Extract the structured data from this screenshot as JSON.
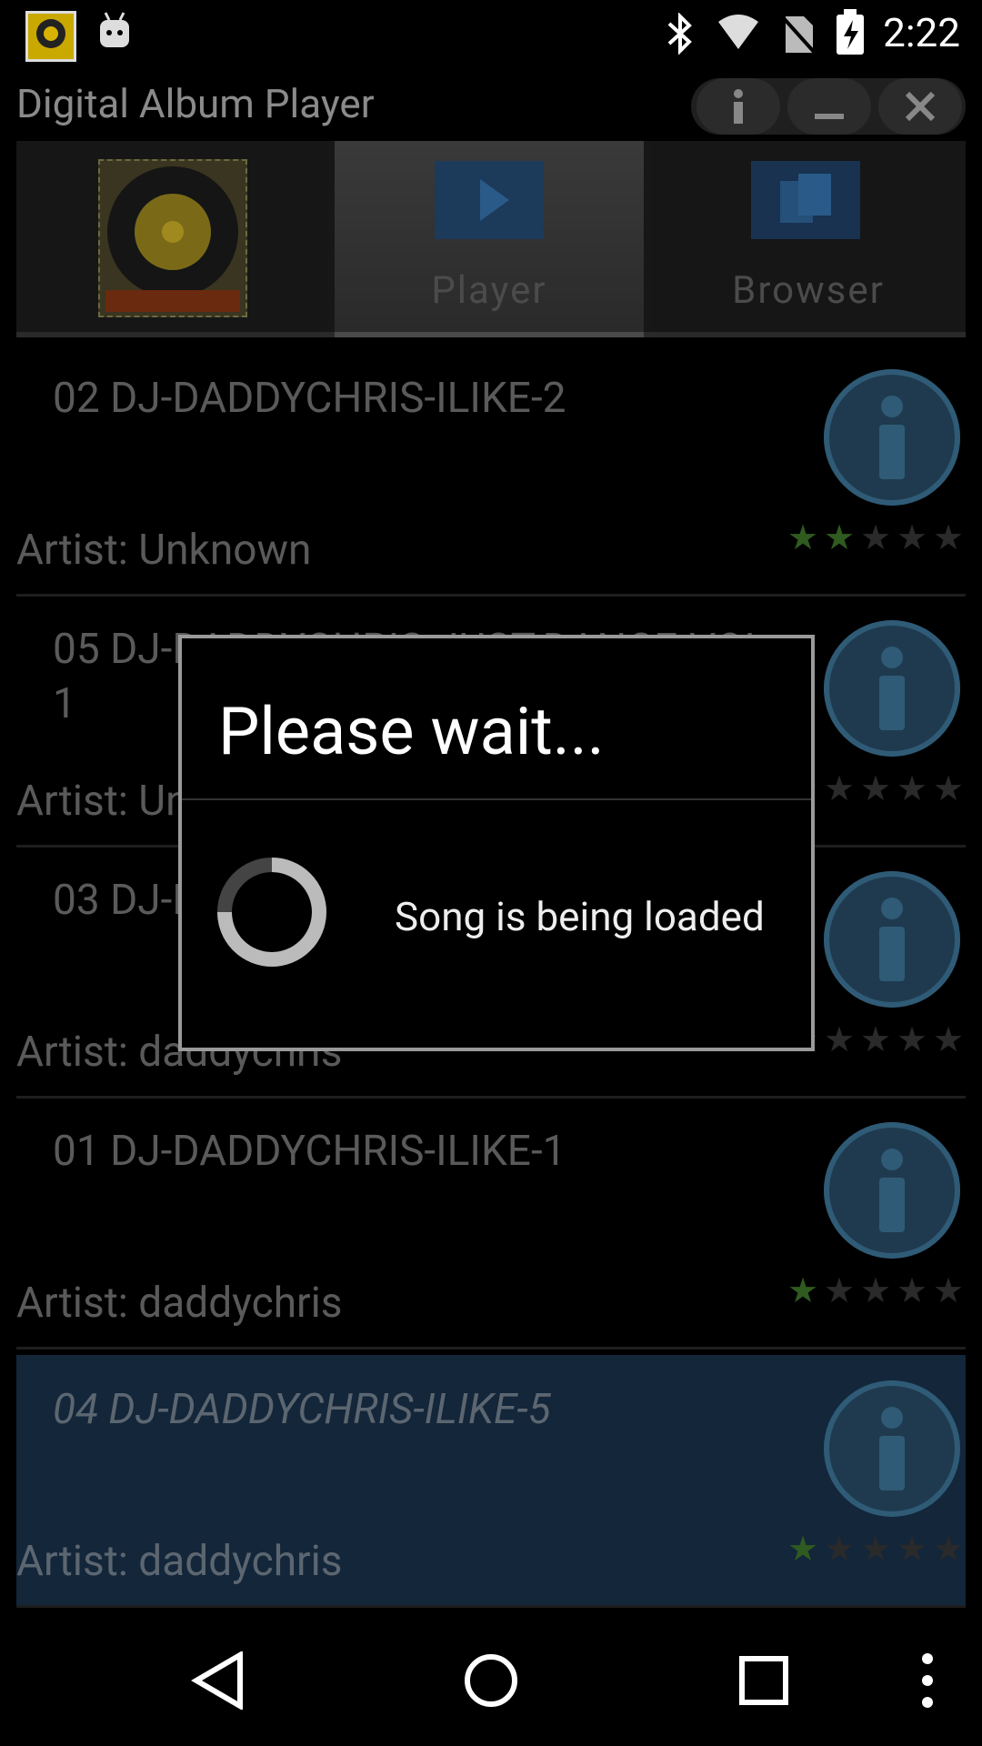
{
  "status_bar": {
    "time": "2:22",
    "icons": [
      "app-notification-icon",
      "android-debug-icon",
      "bluetooth-icon",
      "wifi-icon",
      "no-sim-icon",
      "battery-charging-icon"
    ]
  },
  "app": {
    "title": "Digital Album Player",
    "window_buttons": [
      "info-icon",
      "minimize-icon",
      "close-icon"
    ]
  },
  "tabs": [
    {
      "label": "",
      "icon": "album-disc-icon",
      "active": false
    },
    {
      "label": "Player",
      "icon": "play-icon",
      "active": true
    },
    {
      "label": "Browser",
      "icon": "browser-icon",
      "active": false
    }
  ],
  "songs": [
    {
      "title": "02 DJ-DADDYCHRIS-ILIKE-2",
      "artist": "Artist: Unknown",
      "rating": 2
    },
    {
      "title": "05 DJ-DADDYCHRIS-JUST-DANCE-VOL-1",
      "artist": "Artist: Unknown",
      "rating": 0
    },
    {
      "title": "03 DJ-DADDYCHRIS-ILIKE-3",
      "artist": "Artist: daddychris",
      "rating": 1
    },
    {
      "title": "01 DJ-DADDYCHRIS-ILIKE-1",
      "artist": "Artist: daddychris",
      "rating": 1
    },
    {
      "title": "04 DJ-DADDYCHRIS-ILIKE-5",
      "artist": "Artist: daddychris",
      "rating": 1,
      "selected": true
    }
  ],
  "dialog": {
    "title": "Please wait...",
    "message": "Song is being loaded"
  },
  "nav": [
    "back-icon",
    "home-icon",
    "recents-icon",
    "menu-icon"
  ],
  "colors": {
    "accent_blue": "#2f5b76",
    "star_on": "#2f5a20",
    "selected_row": "#13263a"
  }
}
